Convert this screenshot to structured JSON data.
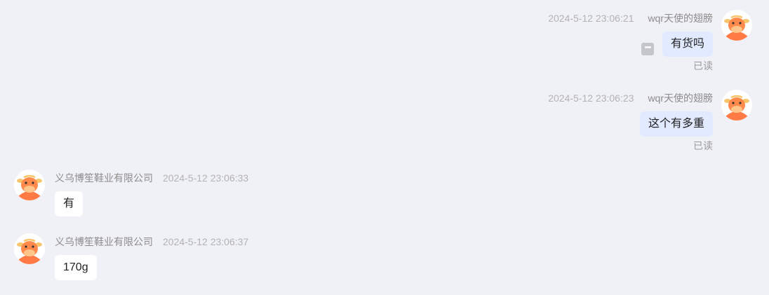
{
  "messages": [
    {
      "side": "right",
      "sender": "wqr天使的翅膀",
      "time": "2024-5-12 23:06:21",
      "text": "有货吗",
      "status": "已读",
      "more_icon": "more-dots-icon"
    },
    {
      "side": "right",
      "sender": "wqr天使的翅膀",
      "time": "2024-5-12 23:06:23",
      "text": "这个有多重",
      "status": "已读"
    },
    {
      "side": "left",
      "sender": "义乌博笙鞋业有限公司",
      "time": "2024-5-12 23:06:33",
      "text": "有"
    },
    {
      "side": "left",
      "sender": "义乌博笙鞋业有限公司",
      "time": "2024-5-12 23:06:37",
      "text": "170g"
    }
  ],
  "colors": {
    "background": "#f0f1f6",
    "outgoing_bubble": "#e1eaff",
    "incoming_bubble": "#ffffff",
    "avatar_accent": "#ff7a45"
  },
  "avatar_icon": "bull-avatar-icon"
}
